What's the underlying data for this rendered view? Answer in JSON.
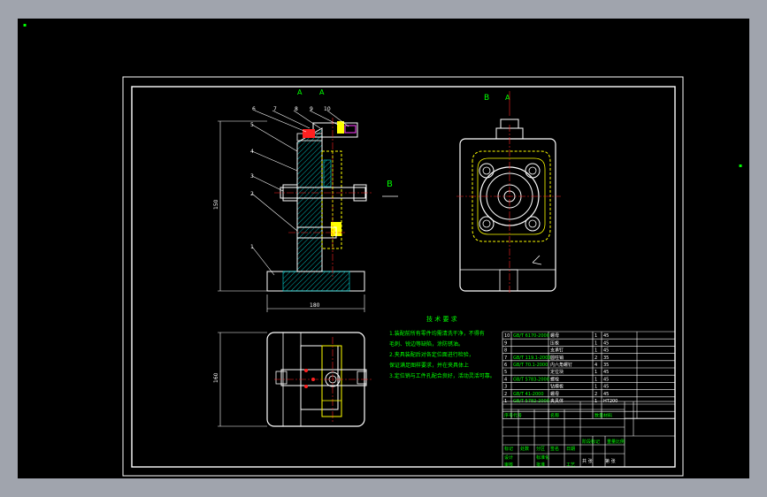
{
  "views": {
    "section_a_label": "A",
    "section_a_label2": "A",
    "section_b_label": "B",
    "section_b_arrow_label": "B",
    "section_b_arrow_label2": "A"
  },
  "part_numbers": [
    "1",
    "2",
    "3",
    "4",
    "5",
    "6",
    "7",
    "8",
    "9",
    "10"
  ],
  "dimensions": {
    "height": "150",
    "width": "180",
    "depth": "160"
  },
  "notes": {
    "title": "技 术 要 求",
    "lines": [
      "1.装配前所有零件均需清洗干净，不得有",
      "毛刺、锐边等缺陷，涂防锈油。",
      "2.夹具装配后对各定位面进行检验，",
      "保证满足图样要求，并在夹具体上",
      "3.定位销与工件孔配合良好，活动灵活可靠。"
    ]
  },
  "bom": {
    "rows": [
      [
        "10",
        "GB/T 6170-2000",
        "螺母",
        "1",
        "45"
      ],
      [
        "9",
        "",
        "压板",
        "1",
        "45"
      ],
      [
        "8",
        "",
        "支承钉",
        "1",
        "45"
      ],
      [
        "7",
        "GB/T 119.1-2000",
        "圆柱销",
        "2",
        "35"
      ],
      [
        "6",
        "GB/T 70.1-2000",
        "内六角螺钉",
        "4",
        "35"
      ],
      [
        "5",
        "",
        "定位块",
        "1",
        "45"
      ],
      [
        "4",
        "GB/T 5783-2000",
        "螺栓",
        "1",
        "45"
      ],
      [
        "3",
        "",
        "钻模板",
        "1",
        "45"
      ],
      [
        "2",
        "GB/T 41-2000",
        "螺母",
        "2",
        "45"
      ],
      [
        "1",
        "GB/T 5782-2000",
        "夹具体",
        "1",
        "HT200"
      ]
    ],
    "header": [
      "序号",
      "代号",
      "名称",
      "数量",
      "材料"
    ]
  },
  "title_block": {
    "c1": "标记",
    "c2": "处数",
    "c3": "分区",
    "c4": "签名",
    "c5": "日期",
    "c6": "设计",
    "c7": "标准化",
    "c8": "审核",
    "c9": "工艺",
    "c10": "批准",
    "c11": "阶段标记",
    "c12": "重量",
    "c13": "比例",
    "c14": "共 张",
    "c15": "第 张"
  },
  "colors": {
    "background": "#000000",
    "frame": "#ffffff",
    "outline": "#ffffff",
    "centerline": "#ff2020",
    "hatch": "#00e0e0",
    "yellow": "#ffff00",
    "green": "#00ff00",
    "magenta": "#ff40ff",
    "window": "#a0a4ad"
  }
}
